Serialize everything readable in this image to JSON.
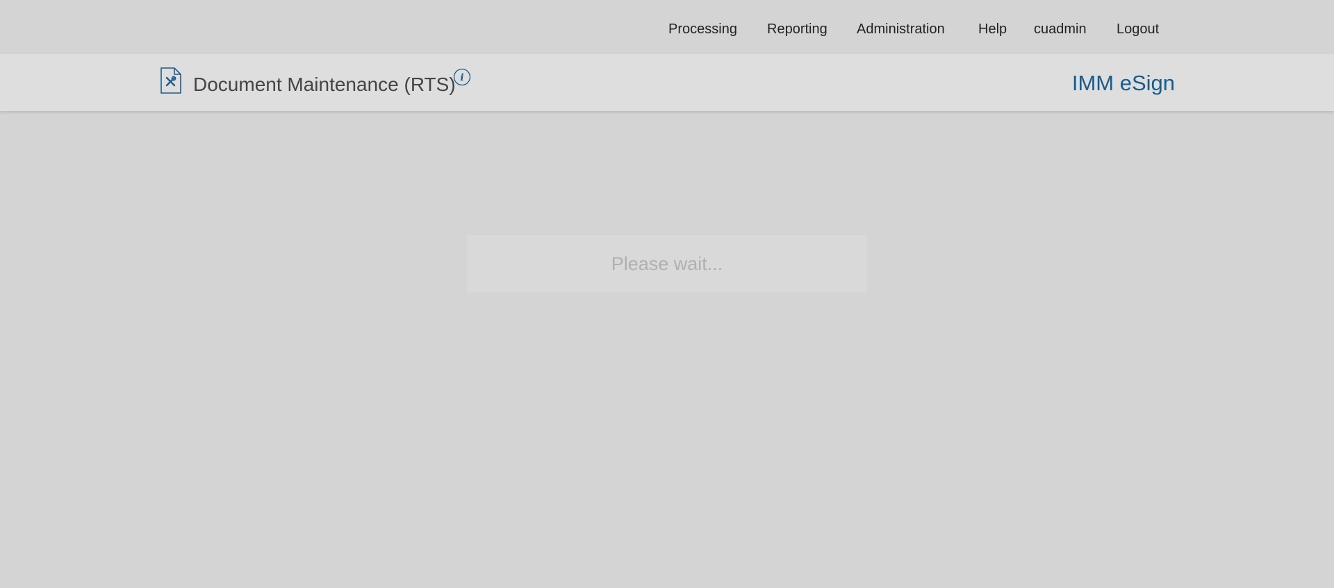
{
  "nav": {
    "items": [
      "Processing",
      "Reporting",
      "Administration",
      "Help",
      "cuadmin",
      "Logout"
    ]
  },
  "header": {
    "title": "Document Maintenance (RTS)",
    "brand": "IMM eSign"
  },
  "icons": {
    "page_icon": "document-tools-icon",
    "info_icon": "info-icon"
  },
  "loading": {
    "message": "Please wait..."
  },
  "colors": {
    "accent": "#1a5b8c",
    "background": "#d4d4d4",
    "titlebar": "#dedede"
  }
}
